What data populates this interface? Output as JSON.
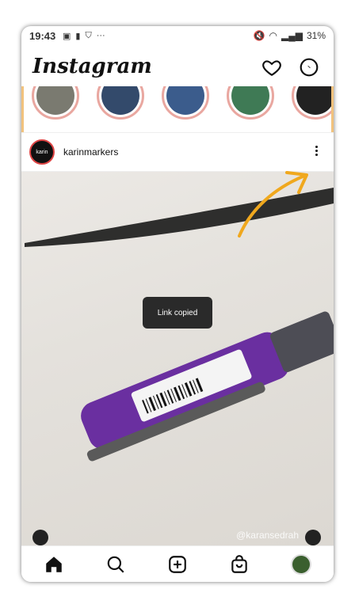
{
  "status_bar": {
    "time": "19:43",
    "battery": "31%"
  },
  "header": {
    "logo": "Instagram",
    "icons": [
      "heart-icon",
      "messenger-icon"
    ]
  },
  "post": {
    "username": "karinmarkers",
    "avatar_text": "karin",
    "watermark": "@karansedrah"
  },
  "toast": {
    "text": "Link copied"
  },
  "bottom_nav": {
    "items": [
      "home-icon",
      "search-icon",
      "add-post-icon",
      "shop-icon",
      "profile-avatar"
    ]
  }
}
